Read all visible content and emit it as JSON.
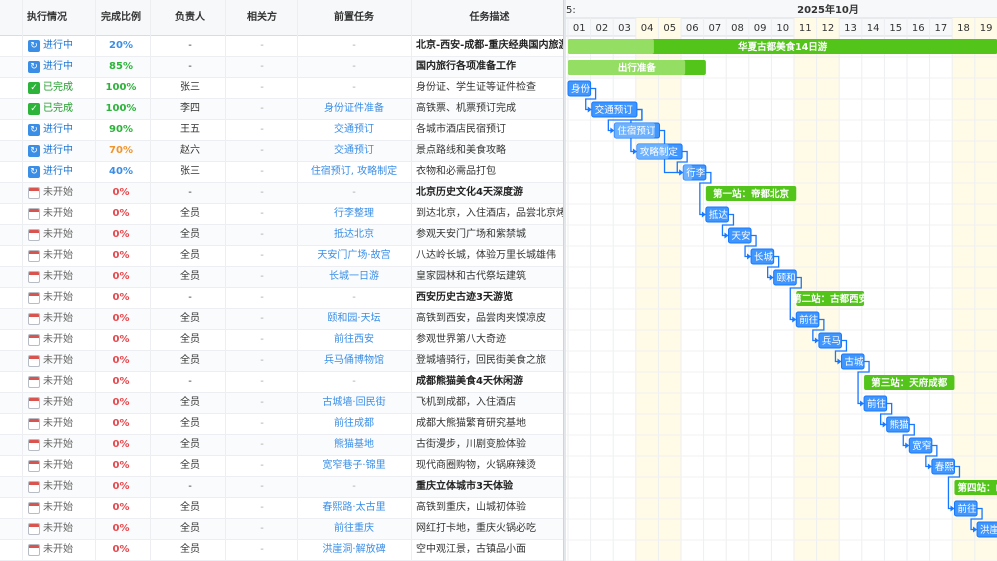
{
  "table": {
    "columns": [
      "执行情况",
      "完成比例",
      "负责人",
      "相关方",
      "前置任务",
      "任务描述"
    ],
    "rows": [
      {
        "status": "进行中",
        "state": "inprog",
        "pct": "20%",
        "pct_color": "blue",
        "owner": "-",
        "related": "-",
        "pre": "-",
        "desc": "北京-西安-成都-重庆经典国内旅游",
        "group": true
      },
      {
        "status": "进行中",
        "state": "inprog",
        "pct": "85%",
        "pct_color": "green",
        "owner": "-",
        "related": "-",
        "pre": "-",
        "desc": "国内旅行各项准备工作",
        "group": true
      },
      {
        "status": "已完成",
        "state": "done",
        "pct": "100%",
        "pct_color": "green",
        "owner": "张三",
        "related": "-",
        "pre": "-",
        "desc": "身份证、学生证等证件检查",
        "group": false
      },
      {
        "status": "已完成",
        "state": "done",
        "pct": "100%",
        "pct_color": "green",
        "owner": "李四",
        "related": "-",
        "pre": "身份证件准备",
        "desc": "高铁票、机票预订完成",
        "group": false
      },
      {
        "status": "进行中",
        "state": "inprog",
        "pct": "90%",
        "pct_color": "green",
        "owner": "王五",
        "related": "-",
        "pre": "交通预订",
        "desc": "各城市酒店民宿预订",
        "group": false
      },
      {
        "status": "进行中",
        "state": "inprog",
        "pct": "70%",
        "pct_color": "orange",
        "owner": "赵六",
        "related": "-",
        "pre": "交通预订",
        "desc": "景点路线和美食攻略",
        "group": false
      },
      {
        "status": "进行中",
        "state": "inprog",
        "pct": "40%",
        "pct_color": "blue",
        "owner": "张三",
        "related": "-",
        "pre": "住宿预订, 攻略制定",
        "desc": "衣物和必需品打包",
        "group": false
      },
      {
        "status": "未开始",
        "state": "todo",
        "pct": "0%",
        "pct_color": "red",
        "owner": "-",
        "related": "-",
        "pre": "-",
        "desc": "北京历史文化4天深度游",
        "group": true
      },
      {
        "status": "未开始",
        "state": "todo",
        "pct": "0%",
        "pct_color": "red",
        "owner": "全员",
        "related": "-",
        "pre": "行李整理",
        "desc": "到达北京，入住酒店，品尝北京烤",
        "group": false
      },
      {
        "status": "未开始",
        "state": "todo",
        "pct": "0%",
        "pct_color": "red",
        "owner": "全员",
        "related": "-",
        "pre": "抵达北京",
        "desc": "参观天安门广场和紫禁城",
        "group": false
      },
      {
        "status": "未开始",
        "state": "todo",
        "pct": "0%",
        "pct_color": "red",
        "owner": "全员",
        "related": "-",
        "pre": "天安门广场·故宫",
        "desc": "八达岭长城，体验万里长城雄伟",
        "group": false
      },
      {
        "status": "未开始",
        "state": "todo",
        "pct": "0%",
        "pct_color": "red",
        "owner": "全员",
        "related": "-",
        "pre": "长城一日游",
        "desc": "皇家园林和古代祭坛建筑",
        "group": false
      },
      {
        "status": "未开始",
        "state": "todo",
        "pct": "0%",
        "pct_color": "red",
        "owner": "-",
        "related": "-",
        "pre": "-",
        "desc": "西安历史古迹3天游览",
        "group": true
      },
      {
        "status": "未开始",
        "state": "todo",
        "pct": "0%",
        "pct_color": "red",
        "owner": "全员",
        "related": "-",
        "pre": "颐和园·天坛",
        "desc": "高铁到西安，品尝肉夹馍凉皮",
        "group": false
      },
      {
        "status": "未开始",
        "state": "todo",
        "pct": "0%",
        "pct_color": "red",
        "owner": "全员",
        "related": "-",
        "pre": "前往西安",
        "desc": "参观世界第八大奇迹",
        "group": false
      },
      {
        "status": "未开始",
        "state": "todo",
        "pct": "0%",
        "pct_color": "red",
        "owner": "全员",
        "related": "-",
        "pre": "兵马俑博物馆",
        "desc": "登城墙骑行，回民街美食之旅",
        "group": false
      },
      {
        "status": "未开始",
        "state": "todo",
        "pct": "0%",
        "pct_color": "red",
        "owner": "-",
        "related": "-",
        "pre": "-",
        "desc": "成都熊猫美食4天休闲游",
        "group": true
      },
      {
        "status": "未开始",
        "state": "todo",
        "pct": "0%",
        "pct_color": "red",
        "owner": "全员",
        "related": "-",
        "pre": "古城墙·回民街",
        "desc": "飞机到成都，入住酒店",
        "group": false
      },
      {
        "status": "未开始",
        "state": "todo",
        "pct": "0%",
        "pct_color": "red",
        "owner": "全员",
        "related": "-",
        "pre": "前往成都",
        "desc": "成都大熊猫繁育研究基地",
        "group": false
      },
      {
        "status": "未开始",
        "state": "todo",
        "pct": "0%",
        "pct_color": "red",
        "owner": "全员",
        "related": "-",
        "pre": "熊猫基地",
        "desc": "古街漫步，川剧变脸体验",
        "group": false
      },
      {
        "status": "未开始",
        "state": "todo",
        "pct": "0%",
        "pct_color": "red",
        "owner": "全员",
        "related": "-",
        "pre": "宽窄巷子·锦里",
        "desc": "现代商圈购物，火锅麻辣烫",
        "group": false
      },
      {
        "status": "未开始",
        "state": "todo",
        "pct": "0%",
        "pct_color": "red",
        "owner": "-",
        "related": "-",
        "pre": "-",
        "desc": "重庆立体城市3天体验",
        "group": true
      },
      {
        "status": "未开始",
        "state": "todo",
        "pct": "0%",
        "pct_color": "red",
        "owner": "全员",
        "related": "-",
        "pre": "春熙路·太古里",
        "desc": "高铁到重庆，山城初体验",
        "group": false
      },
      {
        "status": "未开始",
        "state": "todo",
        "pct": "0%",
        "pct_color": "red",
        "owner": "全员",
        "related": "-",
        "pre": "前往重庆",
        "desc": "网红打卡地，重庆火锅必吃",
        "group": false
      },
      {
        "status": "未开始",
        "state": "todo",
        "pct": "0%",
        "pct_color": "red",
        "owner": "全员",
        "related": "-",
        "pre": "洪崖洞·解放碑",
        "desc": "空中观江景，古镇品小面",
        "group": false
      }
    ]
  },
  "gantt": {
    "month_label": "2025年10月",
    "prev_label": "5:",
    "days": [
      "01",
      "02",
      "03",
      "04",
      "05",
      "06",
      "07",
      "08",
      "09",
      "10",
      "11",
      "12",
      "13",
      "14",
      "15",
      "16",
      "17",
      "18",
      "19"
    ],
    "weekend_days": [
      4,
      5,
      11,
      12,
      18,
      19
    ],
    "colors": {
      "group_bar": "#52c41a",
      "group_bar_light": "#95de64",
      "task_bar": "#4096ff",
      "task_bar_light": "#91caff",
      "link": "#1677ff",
      "weekend": "#fffbe6"
    },
    "bars": [
      {
        "row": 0,
        "label": "华夏古都美食14日游",
        "kind": "group",
        "start": 1,
        "end": 20,
        "progress": 0.2
      },
      {
        "row": 1,
        "label": "出行准备",
        "kind": "group",
        "start": 1,
        "end": 7.1,
        "progress": 0.85
      },
      {
        "row": 2,
        "label": "身份",
        "kind": "task",
        "start": 1,
        "end": 2,
        "progress": 1
      },
      {
        "row": 3,
        "label": "交通预订",
        "kind": "task",
        "start": 2.05,
        "end": 4.05,
        "progress": 1
      },
      {
        "row": 4,
        "label": "住宿预订",
        "kind": "task",
        "start": 3.05,
        "end": 5.05,
        "progress": 0.9
      },
      {
        "row": 5,
        "label": "攻略制定",
        "kind": "task",
        "start": 4.05,
        "end": 6.05,
        "progress": 0.7
      },
      {
        "row": 6,
        "label": "行李",
        "kind": "task",
        "start": 6.1,
        "end": 7.1,
        "progress": 0.4
      },
      {
        "row": 7,
        "label": "第一站：帝都北京",
        "kind": "group",
        "start": 7.1,
        "end": 11.1,
        "progress": 0
      },
      {
        "row": 8,
        "label": "抵达",
        "kind": "task",
        "start": 7.1,
        "end": 8.1,
        "progress": 0
      },
      {
        "row": 9,
        "label": "天安",
        "kind": "task",
        "start": 8.1,
        "end": 9.1,
        "progress": 0
      },
      {
        "row": 10,
        "label": "长城",
        "kind": "task",
        "start": 9.1,
        "end": 10.1,
        "progress": 0
      },
      {
        "row": 11,
        "label": "颐和",
        "kind": "task",
        "start": 10.1,
        "end": 11.1,
        "progress": 0
      },
      {
        "row": 12,
        "label": "第二站：古都西安",
        "kind": "group",
        "start": 11.1,
        "end": 14.1,
        "progress": 0
      },
      {
        "row": 13,
        "label": "前往",
        "kind": "task",
        "start": 11.1,
        "end": 12.1,
        "progress": 0
      },
      {
        "row": 14,
        "label": "兵马",
        "kind": "task",
        "start": 12.1,
        "end": 13.1,
        "progress": 0
      },
      {
        "row": 15,
        "label": "古城",
        "kind": "task",
        "start": 13.1,
        "end": 14.1,
        "progress": 0
      },
      {
        "row": 16,
        "label": "第三站：天府成都",
        "kind": "group",
        "start": 14.1,
        "end": 18.1,
        "progress": 0
      },
      {
        "row": 17,
        "label": "前往",
        "kind": "task",
        "start": 14.1,
        "end": 15.1,
        "progress": 0
      },
      {
        "row": 18,
        "label": "熊猫",
        "kind": "task",
        "start": 15.1,
        "end": 16.1,
        "progress": 0
      },
      {
        "row": 19,
        "label": "宽窄",
        "kind": "task",
        "start": 16.1,
        "end": 17.1,
        "progress": 0
      },
      {
        "row": 20,
        "label": "春熙",
        "kind": "task",
        "start": 17.1,
        "end": 18.1,
        "progress": 0
      },
      {
        "row": 21,
        "label": "第四站：山",
        "kind": "group",
        "start": 18.1,
        "end": 20.5,
        "progress": 0
      },
      {
        "row": 22,
        "label": "前往",
        "kind": "task",
        "start": 18.1,
        "end": 19.1,
        "progress": 0
      },
      {
        "row": 23,
        "label": "洪崖",
        "kind": "task",
        "start": 19.1,
        "end": 20.1,
        "progress": 0
      }
    ],
    "links": [
      [
        2,
        3
      ],
      [
        3,
        4
      ],
      [
        3,
        5
      ],
      [
        4,
        6
      ],
      [
        5,
        6
      ],
      [
        6,
        8
      ],
      [
        8,
        9
      ],
      [
        9,
        10
      ],
      [
        10,
        11
      ],
      [
        11,
        13
      ],
      [
        13,
        14
      ],
      [
        14,
        15
      ],
      [
        15,
        17
      ],
      [
        17,
        18
      ],
      [
        18,
        19
      ],
      [
        19,
        20
      ],
      [
        20,
        22
      ],
      [
        22,
        23
      ]
    ]
  }
}
